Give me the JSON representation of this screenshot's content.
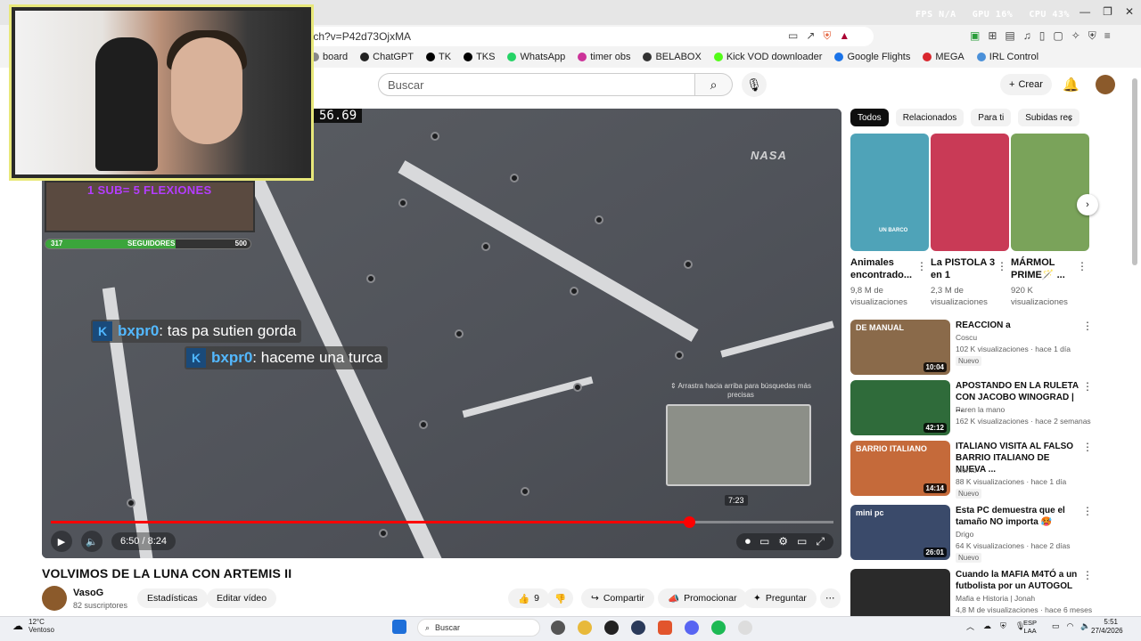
{
  "browser": {
    "url": "tch?v=P42d73OjxMA",
    "sys_stats": [
      "FPS N/A",
      "GPU 16%",
      "CPU 43%"
    ],
    "bookmarks": [
      {
        "label": "board",
        "color": "#888888"
      },
      {
        "label": "ChatGPT",
        "color": "#222222"
      },
      {
        "label": "TK",
        "color": "#000000"
      },
      {
        "label": "TKS",
        "color": "#000000"
      },
      {
        "label": "WhatsApp",
        "color": "#25d366"
      },
      {
        "label": "timer obs",
        "color": "#cc3399"
      },
      {
        "label": "BELABOX",
        "color": "#333333"
      },
      {
        "label": "Kick VOD downloader",
        "color": "#53fc18"
      },
      {
        "label": "Google Flights",
        "color": "#1a73e8"
      },
      {
        "label": "MEGA",
        "color": "#d9272e"
      },
      {
        "label": "IRL Control",
        "color": "#4a90d9"
      }
    ]
  },
  "header": {
    "search_placeholder": "Buscar",
    "create_label": "Crear"
  },
  "player": {
    "timer_overlay": "56.69",
    "watermark": "NASA",
    "chat": [
      {
        "user": "bxpr0",
        "message": ": tas pa sutien gorda"
      },
      {
        "user": "bxpr0",
        "message": ": haceme una turca"
      }
    ],
    "seek_hint": "⇕ Arrastra hacia arriba para búsquedas más precisas",
    "seek_time": "7:23",
    "time_display": "6:50 / 8:24",
    "progress": 0.815
  },
  "stream_overlay": {
    "goal_text": "1 SUB= 5 FLEXIONES",
    "followers_current": "317",
    "followers_label": "SEGUIDORES",
    "followers_goal": "500",
    "followers_fraction": 0.634
  },
  "video": {
    "title": "VOLVIMOS DE LA LUNA CON ARTEMIS II",
    "channel": "VasoG",
    "subscribers": "82 suscriptores",
    "stats_label": "Estadísticas",
    "edit_label": "Editar vídeo",
    "likes": "9",
    "share_label": "Compartir",
    "promote_label": "Promocionar",
    "ask_label": "Preguntar"
  },
  "chips": [
    "Todos",
    "Relacionados",
    "Para ti",
    "Subidas rec"
  ],
  "shorts": [
    {
      "title": "Animales encontrado...",
      "views": "9,8 M de visualizaciones",
      "thumb_color": "#4fa3b8",
      "thumb_label": "UN BARCO"
    },
    {
      "title": "La PISTOLA 3 en 1",
      "views": "2,3 M de visualizaciones",
      "thumb_color": "#c93a56",
      "thumb_label": ""
    },
    {
      "title": "MÁRMOL PRIME🪄 ...",
      "views": "920 K visualizaciones",
      "thumb_color": "#7aa35a",
      "thumb_label": ""
    }
  ],
  "recommendations": [
    {
      "title": "REACCION a",
      "channel": "Coscu",
      "meta": "102 K visualizaciones · hace 1 día",
      "badge": "Nuevo",
      "duration": "10:04",
      "thumb_color": "#8a6a4a",
      "thumb_label": "DE MANUAL"
    },
    {
      "title": "APOSTANDO EN LA RULETA CON JACOBO WINOGRAD | ...",
      "channel": "Paren la mano",
      "meta": "162 K visualizaciones · hace 2 semanas",
      "badge": "",
      "duration": "42:12",
      "thumb_color": "#2f6b3a",
      "thumb_label": ""
    },
    {
      "title": "ITALIANO VISITA AL FALSO BARRIO ITALIANO DE NUEVA ...",
      "channel": "Momo",
      "meta": "88 K visualizaciones · hace 1 día",
      "badge": "Nuevo",
      "duration": "14:14",
      "thumb_color": "#c56a3a",
      "thumb_label": "BARRIO ITALIANO"
    },
    {
      "title": "Esta PC demuestra que el tamaño NO importa 🥵",
      "channel": "Drigo",
      "meta": "64 K visualizaciones · hace 2 días",
      "badge": "Nuevo",
      "duration": "26:01",
      "thumb_color": "#3a4a6a",
      "thumb_label": "mini pc"
    },
    {
      "title": "Cuando la MAFIA M4TÓ a un futbolista por un AUTOGOL",
      "channel": "Mafia e Historia | Jonah",
      "meta": "4,8 M de visualizaciones · hace 6 meses",
      "badge": "",
      "duration": "",
      "thumb_color": "#2a2a2a",
      "thumb_label": ""
    }
  ],
  "taskbar": {
    "temperature": "12°C",
    "weather": "Ventoso",
    "search_label": "Buscar",
    "lang_top": "ESP",
    "lang_bottom": "LAA",
    "time": "5:51",
    "date": "27/4/2026"
  }
}
